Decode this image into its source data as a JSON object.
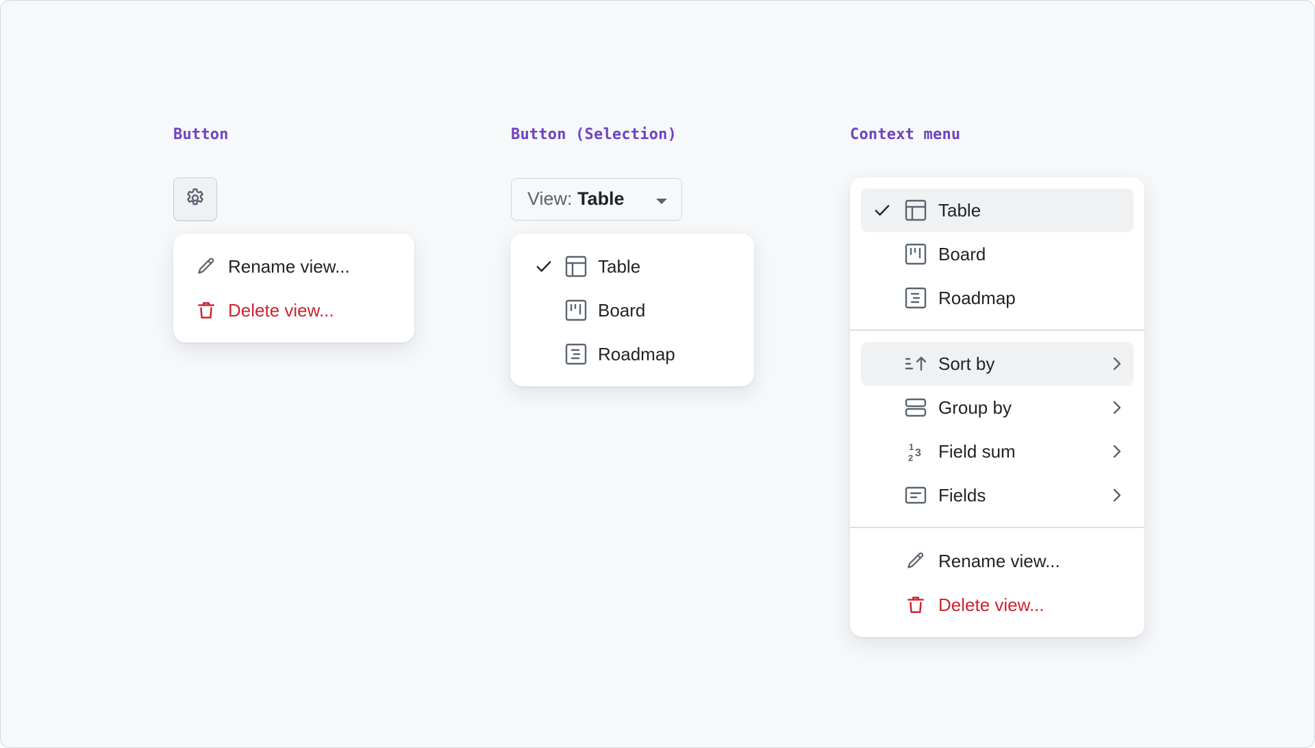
{
  "sections": {
    "button": {
      "label": "Button"
    },
    "selection": {
      "label": "Button (Selection)"
    },
    "context": {
      "label": "Context menu"
    }
  },
  "colors": {
    "accent_label": "#6f42c1",
    "text": "#1f2328",
    "muted": "#59636e",
    "danger": "#cf222e",
    "highlight": "#eff1f3"
  },
  "gear_button": {
    "icon": "gear-icon"
  },
  "button_menu": {
    "items": [
      {
        "label": "Rename view...",
        "icon": "pencil-icon",
        "variant": "default"
      },
      {
        "label": "Delete view...",
        "icon": "trash-icon",
        "variant": "danger"
      }
    ]
  },
  "selection_button": {
    "prefix": "View:",
    "value": "Table",
    "icon": "triangle-down-icon"
  },
  "selection_menu": {
    "items": [
      {
        "label": "Table",
        "icon": "table-icon",
        "checked": true
      },
      {
        "label": "Board",
        "icon": "board-icon",
        "checked": false
      },
      {
        "label": "Roadmap",
        "icon": "roadmap-icon",
        "checked": false
      }
    ]
  },
  "context_menu": {
    "views": [
      {
        "label": "Table",
        "icon": "table-icon",
        "checked": true,
        "highlighted": true
      },
      {
        "label": "Board",
        "icon": "board-icon",
        "checked": false
      },
      {
        "label": "Roadmap",
        "icon": "roadmap-icon",
        "checked": false
      }
    ],
    "options": [
      {
        "label": "Sort by",
        "icon": "sort-asc-icon",
        "submenu": true,
        "highlighted": true
      },
      {
        "label": "Group by",
        "icon": "rows-icon",
        "submenu": true
      },
      {
        "label": "Field sum",
        "icon": "number-icon",
        "submenu": true
      },
      {
        "label": "Fields",
        "icon": "note-icon",
        "submenu": true
      }
    ],
    "actions": [
      {
        "label": "Rename view...",
        "icon": "pencil-icon",
        "variant": "default"
      },
      {
        "label": "Delete view...",
        "icon": "trash-icon",
        "variant": "danger"
      }
    ]
  }
}
